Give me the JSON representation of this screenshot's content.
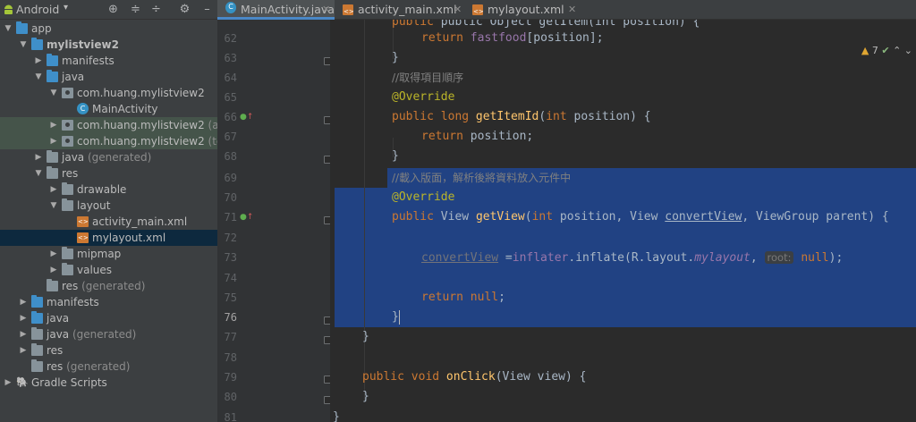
{
  "project": {
    "view_mode": "Android",
    "toolbar_icons": [
      "target-icon",
      "expand-all-icon",
      "collapse-all-icon",
      "gear-icon",
      "hide-icon"
    ],
    "tree": [
      {
        "label": "app",
        "depth": 0,
        "expanded": true,
        "icon": "folder-module-icon",
        "bold": false
      },
      {
        "label": "mylistview2",
        "depth": 1,
        "expanded": true,
        "icon": "folder-module-icon",
        "bold": true
      },
      {
        "label": "manifests",
        "depth": 2,
        "expanded": false,
        "icon": "folder-blue-icon"
      },
      {
        "label": "java",
        "depth": 2,
        "expanded": true,
        "icon": "folder-blue-icon"
      },
      {
        "label": "com.huang.mylistview2",
        "depth": 3,
        "expanded": true,
        "icon": "package-icon"
      },
      {
        "label": "MainActivity",
        "depth": 4,
        "expanded": null,
        "icon": "class-icon"
      },
      {
        "label": "com.huang.mylistview2",
        "suffix": " (andro",
        "depth": 3,
        "expanded": false,
        "icon": "package-icon",
        "highlight": "hl"
      },
      {
        "label": "com.huang.mylistview2",
        "suffix": " (test)",
        "depth": 3,
        "expanded": false,
        "icon": "package-icon",
        "highlight": "hl"
      },
      {
        "label": "java",
        "suffix": " (generated)",
        "depth": 2,
        "expanded": false,
        "icon": "folder-gen-icon"
      },
      {
        "label": "res",
        "depth": 2,
        "expanded": true,
        "icon": "folder-res-icon"
      },
      {
        "label": "drawable",
        "depth": 3,
        "expanded": false,
        "icon": "folder-icon"
      },
      {
        "label": "layout",
        "depth": 3,
        "expanded": true,
        "icon": "folder-icon"
      },
      {
        "label": "activity_main.xml",
        "depth": 4,
        "expanded": null,
        "icon": "xml-icon"
      },
      {
        "label": "mylayout.xml",
        "depth": 4,
        "expanded": null,
        "icon": "xml-icon",
        "highlight": "sel"
      },
      {
        "label": "mipmap",
        "depth": 3,
        "expanded": false,
        "icon": "folder-icon"
      },
      {
        "label": "values",
        "depth": 3,
        "expanded": false,
        "icon": "folder-icon"
      },
      {
        "label": "res",
        "suffix": " (generated)",
        "depth": 2,
        "expanded": null,
        "icon": "folder-res-icon"
      },
      {
        "label": "manifests",
        "depth": 1,
        "expanded": false,
        "icon": "folder-blue-icon"
      },
      {
        "label": "java",
        "depth": 1,
        "expanded": false,
        "icon": "folder-blue-icon"
      },
      {
        "label": "java",
        "suffix": " (generated)",
        "depth": 1,
        "expanded": false,
        "icon": "folder-gen-icon"
      },
      {
        "label": "res",
        "depth": 1,
        "expanded": false,
        "icon": "folder-res-icon"
      },
      {
        "label": "res",
        "suffix": " (generated)",
        "depth": 1,
        "expanded": null,
        "icon": "folder-res-icon"
      },
      {
        "label": "Gradle Scripts",
        "depth": 0,
        "expanded": false,
        "icon": "gradle-icon"
      }
    ]
  },
  "tabs": [
    {
      "label": "MainActivity.java",
      "icon": "class-icon",
      "active": true
    },
    {
      "label": "activity_main.xml",
      "icon": "xml-icon",
      "active": false
    },
    {
      "label": "mylayout.xml",
      "icon": "xml-icon",
      "active": false
    }
  ],
  "inspection": {
    "warnings": "7",
    "warning_icon": "warning-icon",
    "ok_icon": "check-icon"
  },
  "editor": {
    "current_line": "76",
    "line_numbers": [
      "62",
      "63",
      "64",
      "65",
      "66",
      "67",
      "68",
      "69",
      "70",
      "71",
      "72",
      "73",
      "74",
      "75",
      "76",
      "77",
      "78",
      "79",
      "80",
      "81"
    ],
    "partial_top_line": "public Object getItem(int position) {",
    "lines": {
      "l62": {
        "kw": "return ",
        "field": "fastfood",
        "rest": "[position];"
      },
      "l63": "}",
      "l64": "//取得項目順序",
      "l65": "@Override",
      "l66": {
        "kw1": "public long ",
        "fn": "getItemId",
        "p1": "(",
        "kw2": "int ",
        "p2": "position) {"
      },
      "l67": {
        "kw": "return ",
        "rest": "position;"
      },
      "l68": "}",
      "l69": "//載入版面，解析後將資料放入元件中",
      "l70": "@Override",
      "l71": {
        "kw1": "public ",
        "t1": "View ",
        "fn": "getView",
        "p1": "(",
        "kw2": "int ",
        "p2": "position, View ",
        "ul": "convertView",
        "p3": ", ViewGroup parent) {"
      },
      "l73": {
        "ul": "convertView",
        "eq": " =",
        "field": "inflater",
        "p1": ".inflate(R.layout.",
        "ital": "mylayout",
        "p2": ",",
        "hint": "root:",
        "kw": "null",
        "p3": ");"
      },
      "l75": {
        "kw": "return null",
        "rest": ";"
      },
      "l76": "}",
      "l77": "}",
      "l79": {
        "kw": "public void ",
        "fn": "onClick",
        "rest": "(View view) {"
      },
      "l80": "}",
      "l81": "}"
    }
  }
}
